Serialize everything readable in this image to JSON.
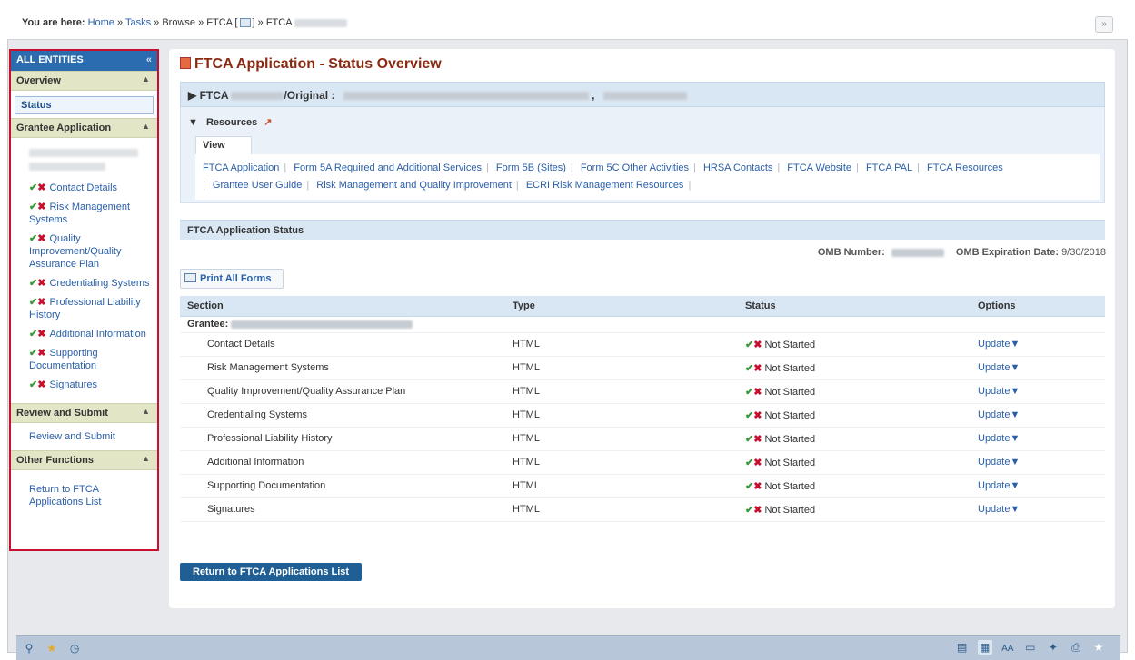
{
  "breadcrumb": {
    "prefix": "You are here:",
    "home": "Home",
    "sep": "»",
    "tasks": "Tasks",
    "browse": "Browse",
    "ftca1": "FTCA [",
    "ftca1_end": "]",
    "ftca2": "FTCA"
  },
  "collapse_icon": "»",
  "sidebar": {
    "header": "ALL ENTITIES",
    "header_icon": "«",
    "overview": "Overview",
    "status": "Status",
    "grantee_app": "Grantee Application",
    "links": [
      "Contact Details",
      "Risk Management Systems",
      "Quality Improvement/Quality Assurance Plan",
      "Credentialing Systems",
      "Professional Liability History",
      "Additional Information",
      "Supporting Documentation",
      "Signatures"
    ],
    "review_section": "Review and Submit",
    "review_link": "Review and Submit",
    "other_section": "Other Functions",
    "return_link": "Return to FTCA Applications List"
  },
  "main": {
    "title": "FTCA Application - Status Overview",
    "ftca_label": "FTCA",
    "original_label": "/Original :",
    "comma": ",",
    "resources": "Resources",
    "view_tab": "View",
    "resource_links": [
      "FTCA Application",
      "Form 5A Required and Additional Services",
      "Form 5B (Sites)",
      "Form 5C Other Activities",
      "HRSA Contacts",
      "FTCA Website",
      "FTCA PAL",
      "FTCA Resources",
      "Grantee User Guide",
      "Risk Management and Quality Improvement",
      "ECRI Risk Management Resources"
    ],
    "status_header": "FTCA Application Status",
    "omb_number_label": "OMB Number:",
    "omb_exp_label": "OMB Expiration Date:",
    "omb_exp_value": "9/30/2018",
    "print_all": "Print All Forms",
    "table": {
      "headers": [
        "Section",
        "Type",
        "Status",
        "Options"
      ],
      "grantee_label": "Grantee:",
      "rows": [
        {
          "section": "Contact Details",
          "type": "HTML",
          "status": "Not Started",
          "option": "Update"
        },
        {
          "section": "Risk Management Systems",
          "type": "HTML",
          "status": "Not Started",
          "option": "Update"
        },
        {
          "section": "Quality Improvement/Quality Assurance Plan",
          "type": "HTML",
          "status": "Not Started",
          "option": "Update"
        },
        {
          "section": "Credentialing Systems",
          "type": "HTML",
          "status": "Not Started",
          "option": "Update"
        },
        {
          "section": "Professional Liability History",
          "type": "HTML",
          "status": "Not Started",
          "option": "Update"
        },
        {
          "section": "Additional Information",
          "type": "HTML",
          "status": "Not Started",
          "option": "Update"
        },
        {
          "section": "Supporting Documentation",
          "type": "HTML",
          "status": "Not Started",
          "option": "Update"
        },
        {
          "section": "Signatures",
          "type": "HTML",
          "status": "Not Started",
          "option": "Update"
        }
      ]
    },
    "return_button": "Return to FTCA Applications List"
  },
  "toolbar": {
    "left_icons": [
      "search-icon",
      "star-icon",
      "history-icon"
    ],
    "right_icons": [
      "export-icon",
      "view-icon",
      "font-size-icon",
      "calculator-icon",
      "settings-icon",
      "print-icon",
      "favorite-icon"
    ],
    "font_size_label": "AA"
  }
}
